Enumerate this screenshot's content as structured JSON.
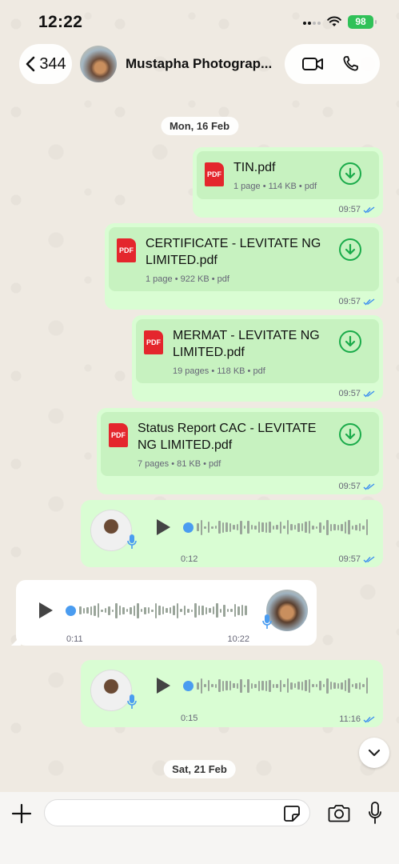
{
  "status_bar": {
    "time": "12:22",
    "battery": "98"
  },
  "header": {
    "back_count": "344",
    "contact_name": "Mustapha Photograp...",
    "icons": [
      "chevron-left-icon",
      "video-call-icon",
      "phone-icon"
    ]
  },
  "date_chips": [
    "Mon, 16 Feb",
    "Sat, 21 Feb"
  ],
  "documents": [
    {
      "title": "TIN.pdf",
      "meta": "1 page • 114 KB • pdf",
      "time": "09:57"
    },
    {
      "title": "CERTIFICATE - LEVITATE NG LIMITED.pdf",
      "meta": "1 page • 922 KB • pdf",
      "time": "09:57"
    },
    {
      "title": "MERMAT - LEVITATE NG LIMITED.pdf",
      "meta": "19 pages • 118 KB • pdf",
      "time": "09:57"
    },
    {
      "title": "Status Report CAC - LEVITATE NG LIMITED.pdf",
      "meta": "7 pages • 81 KB • pdf",
      "time": "09:57"
    }
  ],
  "pdf_badge": "PDF",
  "voice_notes": [
    {
      "direction": "out",
      "duration": "0:12",
      "time": "09:57"
    },
    {
      "direction": "in",
      "duration": "0:11",
      "time": "10:22"
    },
    {
      "direction": "out",
      "duration": "0:15",
      "time": "11:16"
    }
  ],
  "input": {
    "placeholder": ""
  },
  "colors": {
    "outgoing": "#d9fdd3",
    "incoming": "#ffffff",
    "accent": "#1aab4a",
    "read_ticks": "#3b8ef0",
    "pdf": "#e4262d"
  }
}
